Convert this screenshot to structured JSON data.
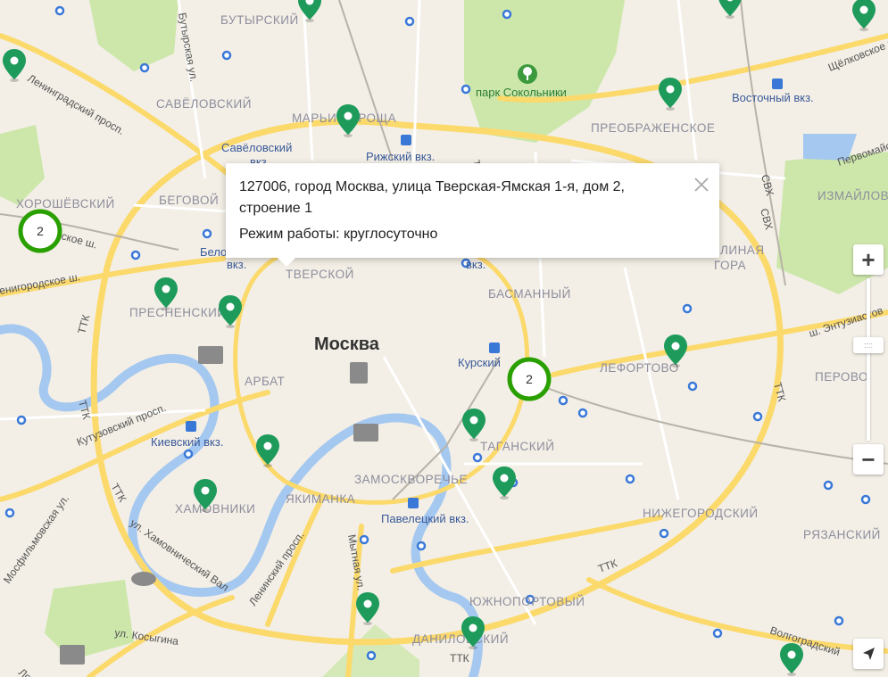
{
  "city_label": "Москва",
  "districts": [
    {
      "id": "butyrsky",
      "text": "БУТЫРСКИЙ"
    },
    {
      "id": "savelovsky",
      "text": "САВЁЛОВСКИЙ"
    },
    {
      "id": "marina-roshcha",
      "text": "МАРЬИНА РОЩА"
    },
    {
      "id": "preobrazhenskoe",
      "text": "ПРЕОБРАЖЕНСКОЕ"
    },
    {
      "id": "khoroshevsky",
      "text": "ХОРОШЁВСКИЙ"
    },
    {
      "id": "begovoy",
      "text": "БЕГОВОЙ"
    },
    {
      "id": "izmaylovo",
      "text": "ИЗМАЙЛОВО"
    },
    {
      "id": "tverskoy",
      "text": "ТВЕРСКОЙ"
    },
    {
      "id": "basmanny",
      "text": "БАСМАННЫЙ"
    },
    {
      "id": "presnensky",
      "text": "ПРЕСНЕНСКИЙ"
    },
    {
      "id": "arbat",
      "text": "АРБАТ"
    },
    {
      "id": "lefortovo",
      "text": "ЛЕФОРТОВО"
    },
    {
      "id": "perovo",
      "text": "ПЕРОВО"
    },
    {
      "id": "tagansky",
      "text": "ТАГАНСКИЙ"
    },
    {
      "id": "zamoskvorechye",
      "text": "ЗАМОСКВОРЕЧЬЕ"
    },
    {
      "id": "yakimanka",
      "text": "ЯКИМАНКА"
    },
    {
      "id": "khamovniki",
      "text": "ХАМОВНИКИ"
    },
    {
      "id": "nizhegorodsky",
      "text": "НИЖЕГОРОДСКИЙ"
    },
    {
      "id": "ryazansky",
      "text": "РЯЗАНСКИЙ"
    },
    {
      "id": "yuzhnoportovy",
      "text": "ЮЖНОПОРТОВЫЙ"
    },
    {
      "id": "danilovsky",
      "text": "ДАНИЛОВСКИЙ"
    },
    {
      "id": "sokolinaya-gora",
      "text": "ЛИНАЯ"
    },
    {
      "id": "sokolinaya-gora-2",
      "text": "ГОРА"
    }
  ],
  "stations": [
    {
      "id": "savelovsky-vkz",
      "text": "Савёловский"
    },
    {
      "id": "savelovsky-vkz-2",
      "text": "вкз."
    },
    {
      "id": "rizhsky-vkz",
      "text": "Рижский вкз."
    },
    {
      "id": "vostochny-vkz",
      "text": "Восточный вкз."
    },
    {
      "id": "belorussky-vkz",
      "text": "Бело"
    },
    {
      "id": "belorussky-vkz-2",
      "text": "вкз."
    },
    {
      "id": "kazansky-vkz",
      "text": "вкз."
    },
    {
      "id": "kursky-vkz",
      "text": "Курский"
    },
    {
      "id": "kievsky-vkz",
      "text": "Киевский вкз."
    },
    {
      "id": "paveletsky-vkz",
      "text": "Павелецкий вкз."
    }
  ],
  "streets": [
    {
      "id": "leningradsky",
      "text": "Ленинградский просп."
    },
    {
      "id": "savelovsky-ul",
      "text": "Бутырская ул."
    },
    {
      "id": "schelkovskoe",
      "text": "Щёлковское ш."
    },
    {
      "id": "pervomayskaya",
      "text": "Первомайская"
    },
    {
      "id": "zvenigorodskoe",
      "text": "енигородское ш."
    },
    {
      "id": "entuziastov",
      "text": "ш. Энтузиастов"
    },
    {
      "id": "kutuzovsky",
      "text": "Кутузовский просп."
    },
    {
      "id": "khamovnichesky-val",
      "text": "ул. Хамовнический Вал"
    },
    {
      "id": "mosfilmovskaya",
      "text": "Мосфильмовская ул."
    },
    {
      "id": "leninsky",
      "text": "Ленинский просп."
    },
    {
      "id": "mytnaya",
      "text": "Мытная ул."
    },
    {
      "id": "kosygina",
      "text": "ул. Косыгина"
    },
    {
      "id": "lomonosovsky",
      "text": "Ломонос"
    },
    {
      "id": "volgogradsky",
      "text": "Волгоградский"
    },
    {
      "id": "ttk-1",
      "text": "ТТК"
    },
    {
      "id": "ttk-2",
      "text": "ТТК"
    },
    {
      "id": "ttk-3",
      "text": "ТТК"
    },
    {
      "id": "ttk-4",
      "text": "ТТК"
    },
    {
      "id": "ttk-5",
      "text": "ТТК"
    },
    {
      "id": "ttk-6",
      "text": "ТТК"
    },
    {
      "id": "ttk-7",
      "text": "ТТК"
    },
    {
      "id": "svkh-1",
      "text": "СВХ"
    },
    {
      "id": "svkh-2",
      "text": "СВХ"
    },
    {
      "id": "skoe-sh",
      "text": "ское ш."
    }
  ],
  "park_label": "парк Сокольники",
  "clusters": [
    {
      "id": "cluster-west",
      "count": "2"
    },
    {
      "id": "cluster-kursky",
      "count": "2"
    }
  ],
  "popup": {
    "address": "127006, город Москва, улица Тверская-Ямская 1-я, дом 2, строение 1",
    "hours": "Режим работы: круглосуточно"
  },
  "controls": {
    "zoom_in": "+",
    "zoom_out": "−"
  },
  "colors": {
    "marker": "#1e9b5b",
    "cluster": "#2aa000",
    "road_major": "#fbd96b",
    "water": "#a4c8f0",
    "park": "#cde7ab",
    "land": "#f3efe6"
  }
}
